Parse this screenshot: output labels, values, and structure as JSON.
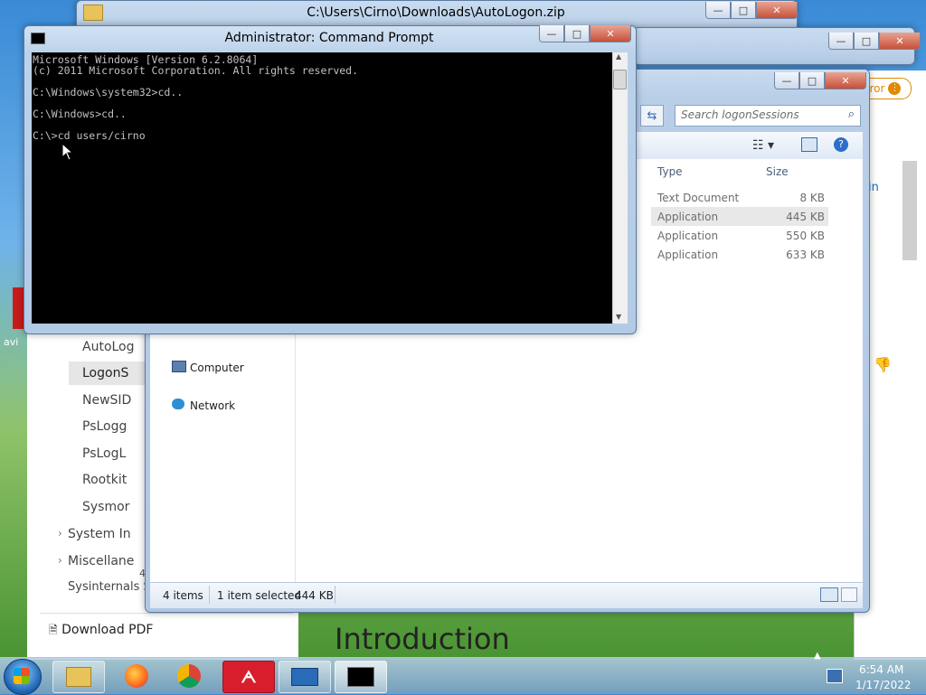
{
  "zip_window": {
    "title": "C:\\Users\\Cirno\\Downloads\\AutoLogon.zip"
  },
  "explorer": {
    "search_placeholder": "Search logonSessions",
    "columns": {
      "type": "Type",
      "size": "Size"
    },
    "rows": [
      {
        "type": "Text Document",
        "size": "8 KB"
      },
      {
        "type": "Application",
        "size": "445 KB"
      },
      {
        "type": "Application",
        "size": "550 KB"
      },
      {
        "type": "Application",
        "size": "633 KB"
      }
    ],
    "nav": {
      "computer": "Computer",
      "network": "Network"
    },
    "status": {
      "items": "4 items",
      "selected": "1 item selected",
      "selected_size": "444 KB"
    }
  },
  "cmd": {
    "title": "Administrator: Command Prompt",
    "lines": [
      "Microsoft Windows [Version 6.2.8064]",
      "(c) 2011 Microsoft Corporation. All rights reserved.",
      "",
      "C:\\Windows\\system32>cd..",
      "",
      "C:\\Windows>cd..",
      "",
      "C:\\>cd users/cirno"
    ]
  },
  "browser_page": {
    "side_items": [
      "AutoLog",
      "LogonS",
      "NewSID",
      "PsLogg",
      "PsLogL",
      "Rootkit",
      "Sysmor"
    ],
    "side_groups": [
      "System In",
      "Miscellane",
      "Sysinternals S"
    ],
    "download_pdf": "Download PDF",
    "heading": "Introduction",
    "error_badge": "ror",
    "link_fragment": "in",
    "sidebar_count": "4"
  },
  "taskbar": {
    "time": "6:54 AM",
    "date": "1/17/2022"
  },
  "desktop": {
    "label_left": "avi"
  }
}
